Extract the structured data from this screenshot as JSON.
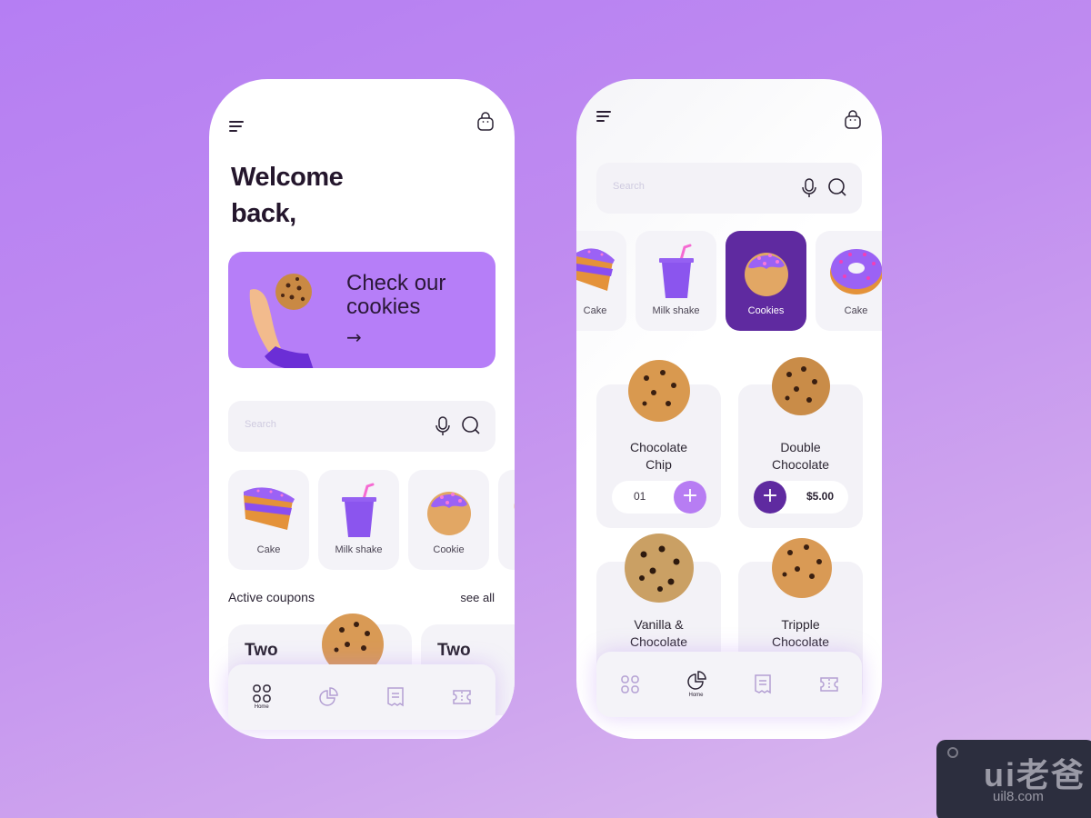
{
  "left_screen": {
    "header": {
      "menu_icon": "hamburger-menu-icon",
      "cart_icon": "shopping-bag-icon"
    },
    "title_line1": "Welcome",
    "title_line2": "back,",
    "banner": {
      "line1": "Check our",
      "line2": "cookies",
      "arrow": "→",
      "color": "#b67ef8"
    },
    "search": {
      "placeholder": "Search",
      "mic_icon": "microphone-icon",
      "search_icon": "search-icon"
    },
    "categories": [
      {
        "label": "Cake"
      },
      {
        "label": "Milk shake"
      },
      {
        "label": "Cookie"
      }
    ],
    "section": {
      "title": "Active coupons",
      "see_all": "see all"
    },
    "coupons": [
      {
        "title": "Two"
      },
      {
        "title": "Two"
      }
    ],
    "nav": {
      "active": "Home",
      "home_label": "Home"
    }
  },
  "right_screen": {
    "header": {
      "menu_icon": "hamburger-menu-icon",
      "cart_icon": "shopping-bag-icon"
    },
    "search": {
      "placeholder": "Search"
    },
    "categories": [
      {
        "label": "Cake",
        "active": false
      },
      {
        "label": "Milk shake",
        "active": false
      },
      {
        "label": "Cookies",
        "active": true
      },
      {
        "label": "Cake",
        "active": false
      }
    ],
    "products": [
      {
        "name_line1": "Chocolate",
        "name_line2": "Chip",
        "quantity": "01",
        "action": "+"
      },
      {
        "name_line1": "Double",
        "name_line2": "Chocolate",
        "price": "$5.00",
        "action": "+"
      },
      {
        "name_line1": "Vanilla &",
        "name_line2": "Chocolate"
      },
      {
        "name_line1": "Tripple",
        "name_line2": "Chocolate"
      }
    ],
    "nav": {
      "active": "Home",
      "home_label": "Home"
    }
  },
  "colors": {
    "accent": "#b67ef8",
    "accent_dark": "#5f2aa0",
    "plus_light": "#b77df3",
    "plus_dark": "#5f2aa0",
    "text_dark": "#24162c"
  },
  "watermark": {
    "logo": "ui老爸",
    "url": "uil8.com"
  }
}
